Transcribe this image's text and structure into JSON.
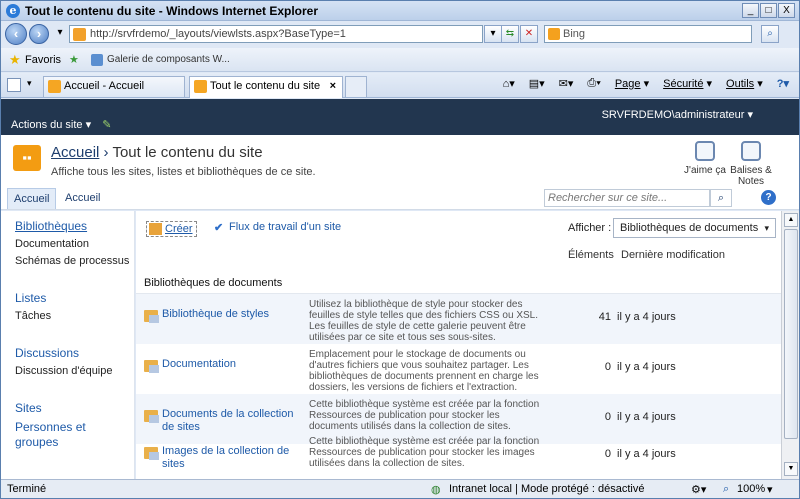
{
  "window": {
    "title": "Tout le contenu du site - Windows Internet Explorer",
    "min": "_",
    "max": "□",
    "close": "X"
  },
  "address": {
    "url": "http://srvfrdemo/_layouts/viewlsts.aspx?BaseType=1",
    "search_placeholder": "Bing"
  },
  "favorites": {
    "label": "Favoris",
    "item": "Galerie de composants W..."
  },
  "tabs": [
    {
      "label": "Accueil - Accueil"
    },
    {
      "label": "Tout le contenu du site"
    }
  ],
  "commands": {
    "page": "Page",
    "security": "Sécurité",
    "tools": "Outils"
  },
  "sp": {
    "user": "SRVFRDEMO\\administrateur",
    "site_actions": "Actions du site",
    "breadcrumb_root": "Accueil",
    "breadcrumb_sep": "›",
    "breadcrumb_current": "Tout le contenu du site",
    "description": "Affiche tous les sites, listes et bibliothèques de ce site.",
    "like": "J'aime ça",
    "tags_line1": "Balises &",
    "tags_line2": "Notes",
    "nav_home": "Accueil",
    "nav_home2": "Accueil",
    "search_placeholder": "Rechercher sur ce site..."
  },
  "left_nav": {
    "libraries": "Bibliothèques",
    "documentation": "Documentation",
    "process": "Schémas de processus",
    "lists": "Listes",
    "tasks": "Tâches",
    "discussions": "Discussions",
    "team_discussion": "Discussion d'équipe",
    "sites": "Sites",
    "people_line1": "Personnes et",
    "people_line2": "groupes"
  },
  "toolbar": {
    "create": "Créer",
    "workflow": "Flux de travail d'un site",
    "show_label": "Afficher :",
    "show_value": "Bibliothèques de documents"
  },
  "columns": {
    "items": "Éléments",
    "modified": "Dernière modification"
  },
  "section": "Bibliothèques de documents",
  "rows": [
    {
      "name": "Bibliothèque de styles",
      "desc": "Utilisez la bibliothèque de style pour stocker des feuilles de style telles que des fichiers CSS ou XSL. Les feuilles de style de cette galerie peuvent être utilisées par ce site et tous ses sous-sites.",
      "count": "41",
      "modified": "il y a 4 jours"
    },
    {
      "name": "Documentation",
      "desc": "Emplacement pour le stockage de documents ou d'autres fichiers que vous souhaitez partager. Les bibliothèques de documents prennent en charge les dossiers, les versions de fichiers et l'extraction.",
      "count": "0",
      "modified": "il y a 4 jours"
    },
    {
      "name": "Documents de la collection de sites",
      "desc": "Cette bibliothèque système est créée par la fonction Ressources de publication pour stocker les documents utilisés dans la collection de sites.",
      "count": "0",
      "modified": "il y a 4 jours"
    },
    {
      "name": "Images de la collection de sites",
      "desc": "Cette bibliothèque système est créée par la fonction Ressources de publication pour stocker les images utilisées dans la collection de sites.",
      "count": "0",
      "modified": "il y a 4 jours"
    }
  ],
  "status": {
    "left": "Terminé",
    "zone": "Intranet local | Mode protégé : désactivé",
    "zoom": "100%"
  }
}
